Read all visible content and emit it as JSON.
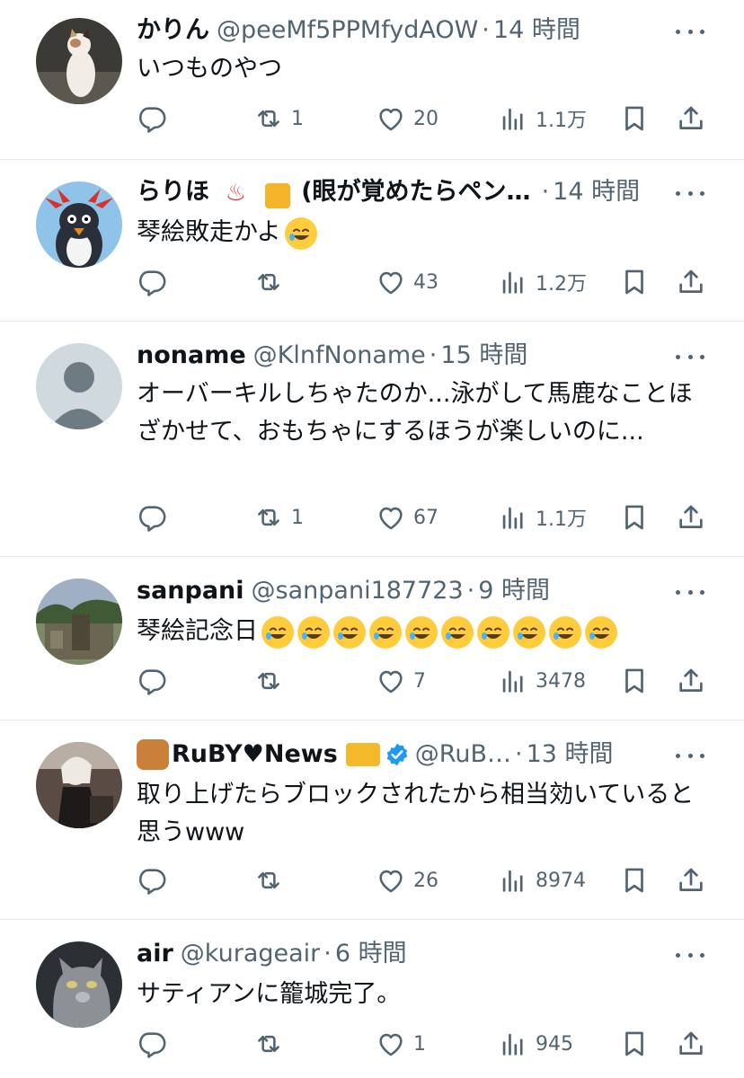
{
  "tweets": [
    {
      "name": "かりん",
      "handle": "@peeMf5PPMfydAOW",
      "time": "14 時間",
      "text": "いつものやつ",
      "replies": "",
      "retweets": "1",
      "likes": "20",
      "views": "1.1万",
      "avatar": "cat-photo"
    },
    {
      "name": "らりほ",
      "name_suffix": "(眼が覚めたらペン…",
      "handle": "",
      "time": "14 時間",
      "text": "琴絵敗走かよ",
      "text_emojis": [
        "rofl-emoji"
      ],
      "replies": "",
      "retweets": "",
      "likes": "43",
      "views": "1.2万",
      "avatar": "penguin-illustration"
    },
    {
      "name": "noname",
      "handle": "@KlnfNoname",
      "time": "15 時間",
      "text": "オーバーキルしちゃたのか...泳がして馬鹿なことほざかせて、おもちゃにするほうが楽しいのに...",
      "replies": "",
      "retweets": "1",
      "likes": "67",
      "views": "1.1万",
      "avatar": "default-user"
    },
    {
      "name": "sanpani",
      "handle": "@sanpani187723",
      "time": "9 時間",
      "text": "琴絵記念日",
      "text_emojis": [
        "sweat-smile-emoji",
        "laughing-emoji",
        "joy-emoji",
        "rofl-emoji",
        "joy-emoji",
        "rofl-emoji",
        "joy-emoji",
        "rofl-emoji",
        "joy-emoji",
        "rofl-emoji"
      ],
      "replies": "",
      "retweets": "",
      "likes": "7",
      "views": "3478",
      "avatar": "ruins-photo"
    },
    {
      "name": "RuBY♥News",
      "handle": "@RuB…",
      "time": "13 時間",
      "text": "取り上げたらブロックされたから相当効いていると思うwww",
      "replies": "",
      "retweets": "",
      "likes": "26",
      "views": "8974",
      "avatar": "person-photo"
    },
    {
      "name": "air",
      "handle": "@kurageair",
      "time": "6 時間",
      "text": "サティアンに籠城完了。",
      "replies": "",
      "retweets": "",
      "likes": "1",
      "views": "945",
      "avatar": "gray-cat-photo"
    }
  ],
  "colors": {
    "text": "#0f1419",
    "secondary": "#536471",
    "divider": "#e6e9eb",
    "verified": "#1d9bf0"
  }
}
